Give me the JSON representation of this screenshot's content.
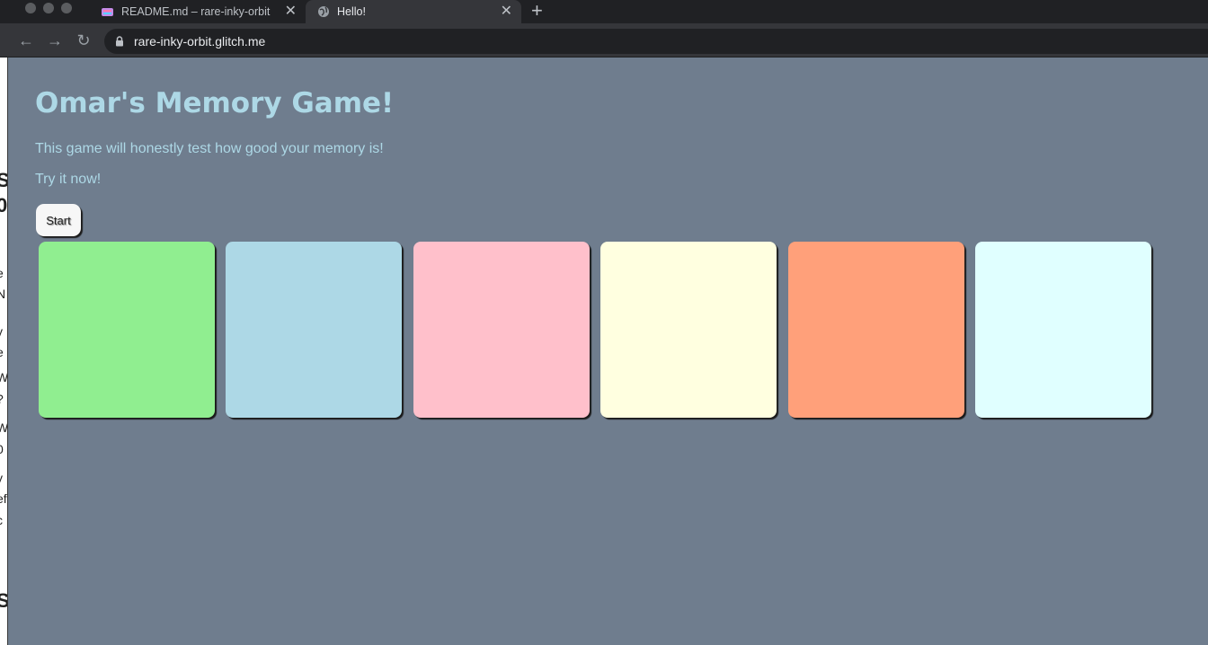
{
  "browser": {
    "tabs": [
      {
        "title": "README.md – rare-inky-orbit",
        "favicon": "glitch-icon",
        "active": false
      },
      {
        "title": "Hello!",
        "favicon": "globe-icon",
        "active": true
      }
    ],
    "new_tab_symbol": "+",
    "close_symbol": "✕",
    "nav": {
      "back": "←",
      "forward": "→",
      "reload": "↻"
    },
    "url": "rare-inky-orbit.glitch.me"
  },
  "page": {
    "title": "Omar's Memory Game!",
    "description": "This game will honestly test how good your memory is!",
    "cta": "Try it now!",
    "start_button": "Start"
  },
  "cards": [
    {
      "color": "#90ee90"
    },
    {
      "color": "#add8e6"
    },
    {
      "color": "#ffc0cb"
    },
    {
      "color": "#ffffe0"
    },
    {
      "color": "#ffa07a"
    },
    {
      "color": "#e0ffff"
    }
  ],
  "colors": {
    "page_background": "#6f7d8e",
    "text": "#add8e6"
  },
  "background_window_fragments": [
    "S",
    "0",
    "e",
    "N",
    "y",
    "e",
    "W",
    "?",
    "W",
    "0",
    "y",
    "ef",
    "c",
    "S"
  ]
}
